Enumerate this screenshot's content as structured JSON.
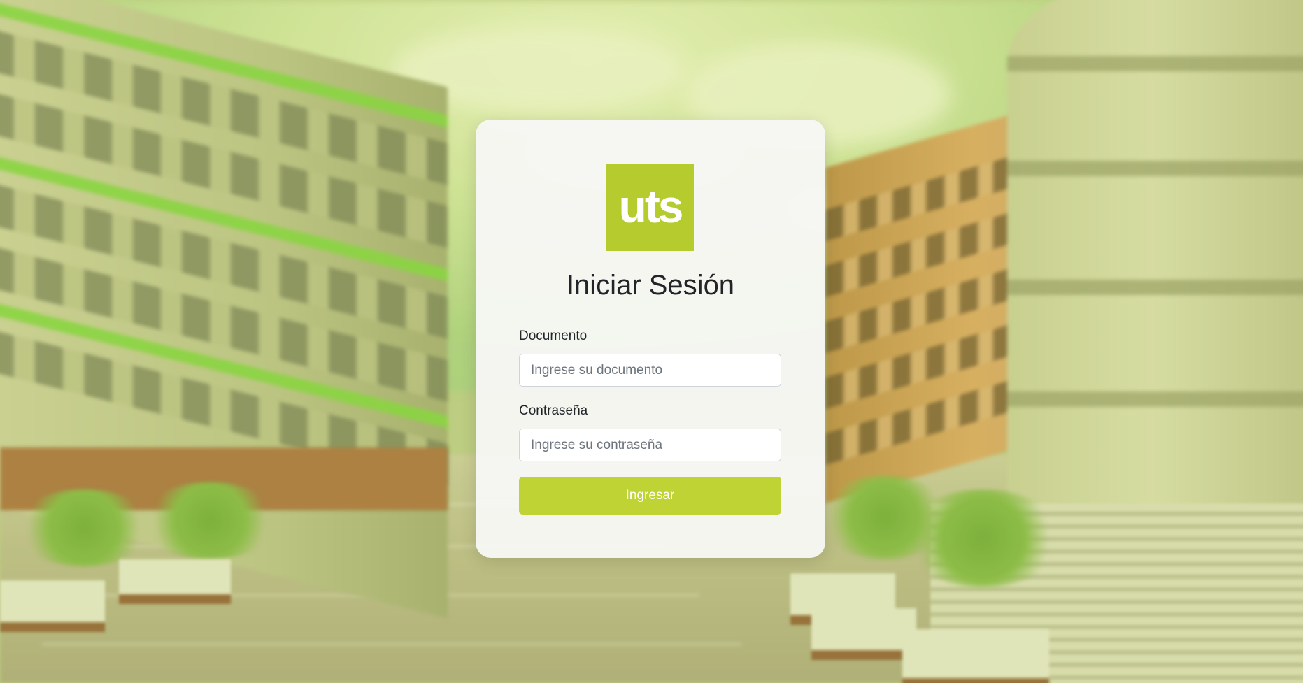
{
  "brand": {
    "logo_text": "uts",
    "accent_color": "#bfd334"
  },
  "login": {
    "title": "Iniciar Sesión",
    "document_label": "Documento",
    "document_placeholder": "Ingrese su documento",
    "password_label": "Contraseña",
    "password_placeholder": "Ingrese su contraseña",
    "submit_label": "Ingresar"
  }
}
